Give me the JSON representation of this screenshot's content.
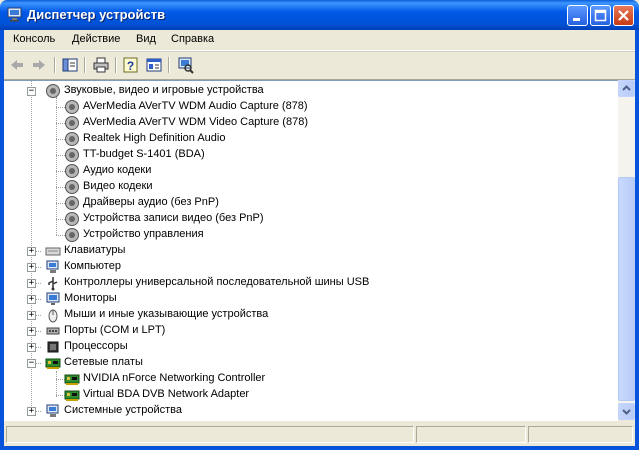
{
  "window": {
    "title": "Диспетчер устройств"
  },
  "menu": {
    "items": [
      "Консоль",
      "Действие",
      "Вид",
      "Справка"
    ]
  },
  "tree": {
    "sound_group": {
      "label": "Звуковые, видео и игровые устройства",
      "children": [
        "AVerMedia AVerTV WDM Audio Capture (878)",
        "AVerMedia AVerTV WDM Video Capture (878)",
        "Realtek High Definition Audio",
        "TT-budget S-1401 (BDA)",
        "Аудио кодеки",
        "Видео кодеки",
        "Драйверы аудио (без PnP)",
        "Устройства записи видео (без PnP)",
        "Устройство управления"
      ]
    },
    "groups": [
      {
        "label": "Клавиатуры",
        "icon": "keyboard-icon"
      },
      {
        "label": "Компьютер",
        "icon": "computer-icon"
      },
      {
        "label": "Контроллеры универсальной последовательной шины USB",
        "icon": "usb-icon"
      },
      {
        "label": "Мониторы",
        "icon": "monitor-icon"
      },
      {
        "label": "Мыши и иные указывающие устройства",
        "icon": "mouse-icon"
      },
      {
        "label": "Порты (COM и LPT)",
        "icon": "port-icon"
      },
      {
        "label": "Процессоры",
        "icon": "processor-icon"
      }
    ],
    "network_group": {
      "label": "Сетевые платы",
      "children": [
        "NVIDIA nForce Networking Controller",
        "Virtual BDA DVB Network Adapter"
      ]
    },
    "last_group": {
      "label": "Системные устройства"
    }
  },
  "colors": {
    "title_bar": "#0054e3",
    "window_bg": "#ece9d8",
    "accent": "#316ac5"
  }
}
